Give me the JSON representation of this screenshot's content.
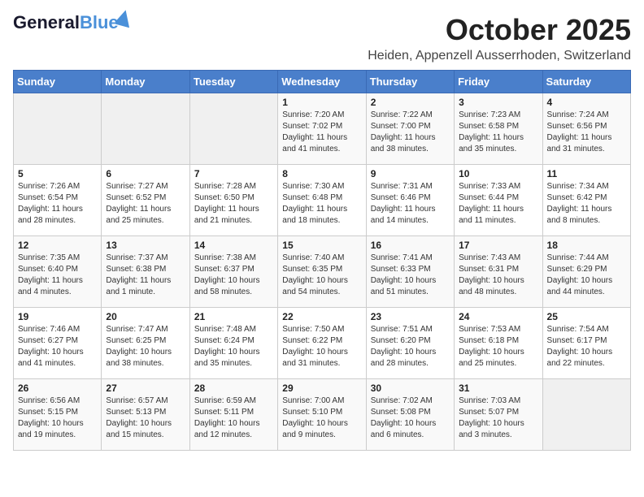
{
  "header": {
    "logo_line1": "General",
    "logo_line2": "Blue",
    "month": "October 2025",
    "location": "Heiden, Appenzell Ausserrhoden, Switzerland"
  },
  "weekdays": [
    "Sunday",
    "Monday",
    "Tuesday",
    "Wednesday",
    "Thursday",
    "Friday",
    "Saturday"
  ],
  "weeks": [
    [
      {
        "day": "",
        "info": ""
      },
      {
        "day": "",
        "info": ""
      },
      {
        "day": "",
        "info": ""
      },
      {
        "day": "1",
        "info": "Sunrise: 7:20 AM\nSunset: 7:02 PM\nDaylight: 11 hours and 41 minutes."
      },
      {
        "day": "2",
        "info": "Sunrise: 7:22 AM\nSunset: 7:00 PM\nDaylight: 11 hours and 38 minutes."
      },
      {
        "day": "3",
        "info": "Sunrise: 7:23 AM\nSunset: 6:58 PM\nDaylight: 11 hours and 35 minutes."
      },
      {
        "day": "4",
        "info": "Sunrise: 7:24 AM\nSunset: 6:56 PM\nDaylight: 11 hours and 31 minutes."
      }
    ],
    [
      {
        "day": "5",
        "info": "Sunrise: 7:26 AM\nSunset: 6:54 PM\nDaylight: 11 hours and 28 minutes."
      },
      {
        "day": "6",
        "info": "Sunrise: 7:27 AM\nSunset: 6:52 PM\nDaylight: 11 hours and 25 minutes."
      },
      {
        "day": "7",
        "info": "Sunrise: 7:28 AM\nSunset: 6:50 PM\nDaylight: 11 hours and 21 minutes."
      },
      {
        "day": "8",
        "info": "Sunrise: 7:30 AM\nSunset: 6:48 PM\nDaylight: 11 hours and 18 minutes."
      },
      {
        "day": "9",
        "info": "Sunrise: 7:31 AM\nSunset: 6:46 PM\nDaylight: 11 hours and 14 minutes."
      },
      {
        "day": "10",
        "info": "Sunrise: 7:33 AM\nSunset: 6:44 PM\nDaylight: 11 hours and 11 minutes."
      },
      {
        "day": "11",
        "info": "Sunrise: 7:34 AM\nSunset: 6:42 PM\nDaylight: 11 hours and 8 minutes."
      }
    ],
    [
      {
        "day": "12",
        "info": "Sunrise: 7:35 AM\nSunset: 6:40 PM\nDaylight: 11 hours and 4 minutes."
      },
      {
        "day": "13",
        "info": "Sunrise: 7:37 AM\nSunset: 6:38 PM\nDaylight: 11 hours and 1 minute."
      },
      {
        "day": "14",
        "info": "Sunrise: 7:38 AM\nSunset: 6:37 PM\nDaylight: 10 hours and 58 minutes."
      },
      {
        "day": "15",
        "info": "Sunrise: 7:40 AM\nSunset: 6:35 PM\nDaylight: 10 hours and 54 minutes."
      },
      {
        "day": "16",
        "info": "Sunrise: 7:41 AM\nSunset: 6:33 PM\nDaylight: 10 hours and 51 minutes."
      },
      {
        "day": "17",
        "info": "Sunrise: 7:43 AM\nSunset: 6:31 PM\nDaylight: 10 hours and 48 minutes."
      },
      {
        "day": "18",
        "info": "Sunrise: 7:44 AM\nSunset: 6:29 PM\nDaylight: 10 hours and 44 minutes."
      }
    ],
    [
      {
        "day": "19",
        "info": "Sunrise: 7:46 AM\nSunset: 6:27 PM\nDaylight: 10 hours and 41 minutes."
      },
      {
        "day": "20",
        "info": "Sunrise: 7:47 AM\nSunset: 6:25 PM\nDaylight: 10 hours and 38 minutes."
      },
      {
        "day": "21",
        "info": "Sunrise: 7:48 AM\nSunset: 6:24 PM\nDaylight: 10 hours and 35 minutes."
      },
      {
        "day": "22",
        "info": "Sunrise: 7:50 AM\nSunset: 6:22 PM\nDaylight: 10 hours and 31 minutes."
      },
      {
        "day": "23",
        "info": "Sunrise: 7:51 AM\nSunset: 6:20 PM\nDaylight: 10 hours and 28 minutes."
      },
      {
        "day": "24",
        "info": "Sunrise: 7:53 AM\nSunset: 6:18 PM\nDaylight: 10 hours and 25 minutes."
      },
      {
        "day": "25",
        "info": "Sunrise: 7:54 AM\nSunset: 6:17 PM\nDaylight: 10 hours and 22 minutes."
      }
    ],
    [
      {
        "day": "26",
        "info": "Sunrise: 6:56 AM\nSunset: 5:15 PM\nDaylight: 10 hours and 19 minutes."
      },
      {
        "day": "27",
        "info": "Sunrise: 6:57 AM\nSunset: 5:13 PM\nDaylight: 10 hours and 15 minutes."
      },
      {
        "day": "28",
        "info": "Sunrise: 6:59 AM\nSunset: 5:11 PM\nDaylight: 10 hours and 12 minutes."
      },
      {
        "day": "29",
        "info": "Sunrise: 7:00 AM\nSunset: 5:10 PM\nDaylight: 10 hours and 9 minutes."
      },
      {
        "day": "30",
        "info": "Sunrise: 7:02 AM\nSunset: 5:08 PM\nDaylight: 10 hours and 6 minutes."
      },
      {
        "day": "31",
        "info": "Sunrise: 7:03 AM\nSunset: 5:07 PM\nDaylight: 10 hours and 3 minutes."
      },
      {
        "day": "",
        "info": ""
      }
    ]
  ]
}
